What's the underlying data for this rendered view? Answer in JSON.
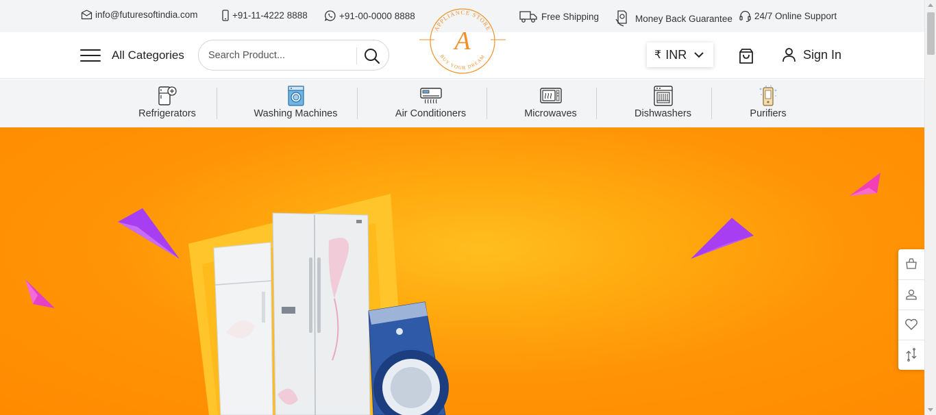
{
  "topbar": {
    "email": "info@futuresoftindia.com",
    "phone": "+91-11-4222 8888",
    "whatsapp": "+91-00-0000 8888",
    "free_shipping": "Free Shipping",
    "money_back": "Money Back Guarantee",
    "support": "24/7 Online Support"
  },
  "header": {
    "all_categories": "All Categories",
    "search_placeholder": "Search Product...",
    "logo": {
      "letter": "A",
      "arc_top": "APPLIANCE STORE",
      "arc_bottom": "BUY YOUR DREAM"
    },
    "currency": {
      "symbol": "₹",
      "code": "INR"
    },
    "signin": "Sign In"
  },
  "categories": [
    {
      "label": "Refrigerators",
      "icon": "refrigerator-icon"
    },
    {
      "label": "Washing Machines",
      "icon": "washing-machine-icon"
    },
    {
      "label": "Air Conditioners",
      "icon": "air-conditioner-icon"
    },
    {
      "label": "Microwaves",
      "icon": "microwave-icon"
    },
    {
      "label": "Dishwashers",
      "icon": "dishwasher-icon"
    },
    {
      "label": "Purifiers",
      "icon": "purifier-icon"
    }
  ],
  "colors": {
    "brand_orange": "#ff8a00",
    "hero_highlight": "#ffbe1f",
    "accent_purple": "#a73ef2",
    "accent_pink": "#f23fb6",
    "logo_orange": "#f0902a"
  },
  "sidebar": {
    "icons": [
      "bag-icon",
      "user-icon",
      "heart-icon",
      "compare-icon"
    ]
  }
}
